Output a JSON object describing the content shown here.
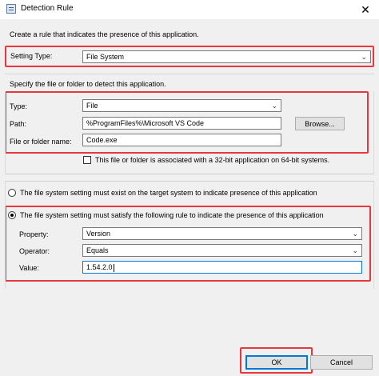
{
  "window": {
    "title": "Detection Rule",
    "close_glyph": "✕"
  },
  "intro": "Create a rule that indicates the presence of this application.",
  "setting_type": {
    "label": "Setting Type:",
    "value": "File System"
  },
  "file_section": {
    "heading": "Specify the file or folder to detect this application.",
    "type_label": "Type:",
    "type_value": "File",
    "path_label": "Path:",
    "path_value": "%ProgramFiles%\\Microsoft VS Code",
    "browse_label": "Browse...",
    "name_label": "File or folder name:",
    "name_value": "Code.exe",
    "bit32_label": "This file or folder is associated with a 32-bit application on 64-bit systems."
  },
  "options": {
    "exist_label": "The file system setting must exist on the target system to indicate presence of this application",
    "rule_label": "The file system setting must satisfy the following rule to indicate the presence of this application",
    "selected": "rule"
  },
  "rule": {
    "property_label": "Property:",
    "property_value": "Version",
    "operator_label": "Operator:",
    "operator_value": "Equals",
    "value_label": "Value:",
    "value_value": "1.54.2.0"
  },
  "footer": {
    "ok_label": "OK",
    "cancel_label": "Cancel"
  },
  "colors": {
    "highlight": "#e8383d",
    "focus": "#0078d7"
  }
}
